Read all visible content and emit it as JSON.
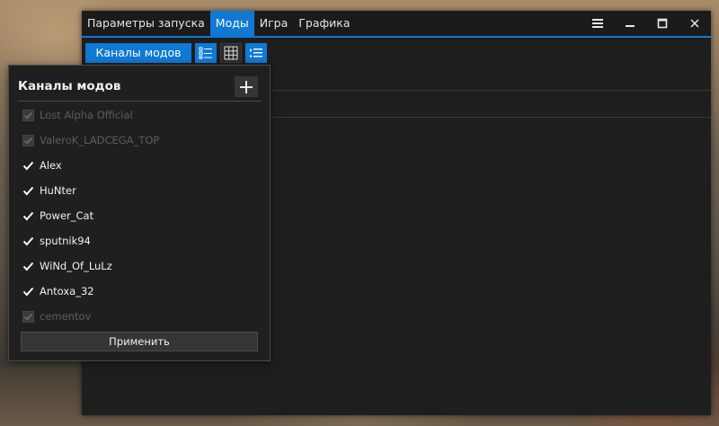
{
  "tabs": [
    {
      "label": "Параметры запуска",
      "active": false
    },
    {
      "label": "Моды",
      "active": true
    },
    {
      "label": "Игра",
      "active": false
    },
    {
      "label": "Графика",
      "active": false
    }
  ],
  "toolbar": {
    "channels_button": "Каналы модов",
    "view_icons": [
      "list-view-icon",
      "grid-view-icon",
      "detail-view-icon"
    ]
  },
  "window_controls": [
    "menu-icon",
    "minimize-icon",
    "maximize-icon",
    "close-icon"
  ],
  "panel": {
    "title": "Каналы модов",
    "add_icon": "plus-icon",
    "items": [
      {
        "label": "Lost Alpha Official",
        "checked": true,
        "enabled": false
      },
      {
        "label": "ValeroK_LADCEGA_TOP",
        "checked": true,
        "enabled": false
      },
      {
        "label": "Alex",
        "checked": true,
        "enabled": true
      },
      {
        "label": "HuNter",
        "checked": true,
        "enabled": true
      },
      {
        "label": "Power_Cat",
        "checked": true,
        "enabled": true
      },
      {
        "label": "sputnik94",
        "checked": true,
        "enabled": true
      },
      {
        "label": "WiNd_Of_LuLz",
        "checked": true,
        "enabled": true
      },
      {
        "label": "Antoxa_32",
        "checked": true,
        "enabled": true
      },
      {
        "label": "cementov",
        "checked": true,
        "enabled": false
      }
    ],
    "apply_button": "Применить"
  },
  "colors": {
    "accent": "#0f79d4",
    "window_bg": "#1e1e1e",
    "panel_bg": "#1f1f1f",
    "disabled_text": "#5c5c5c"
  }
}
